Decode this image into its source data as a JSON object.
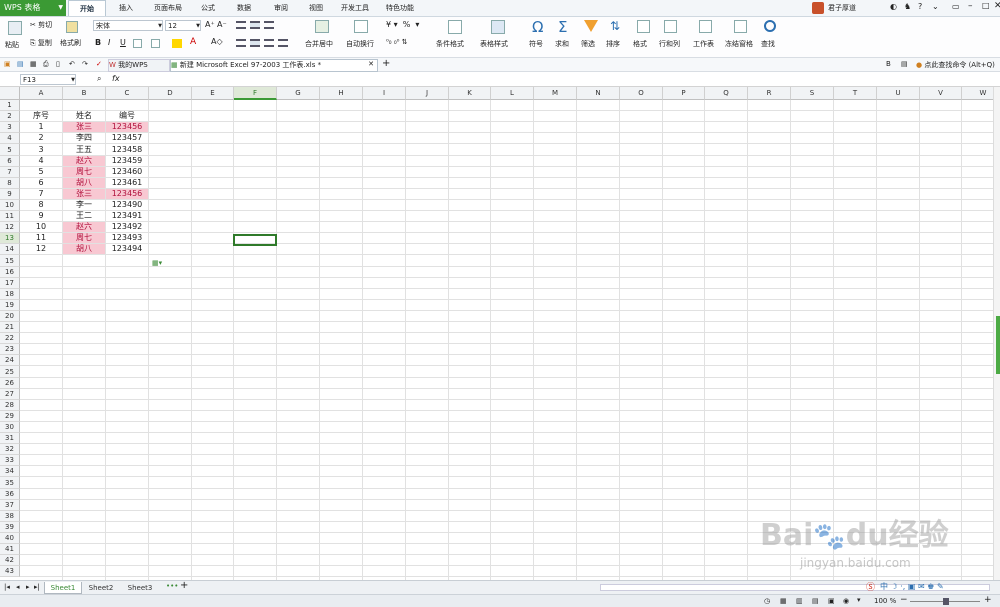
{
  "app": {
    "name": "WPS 表格"
  },
  "menu_tabs": [
    "开始",
    "插入",
    "页面布局",
    "公式",
    "数据",
    "审阅",
    "视图",
    "开发工具",
    "特色功能"
  ],
  "user": {
    "name": "君子厚道"
  },
  "ribbon": {
    "clipboard": {
      "paste": "粘贴",
      "cut": "剪切",
      "copy": "复制",
      "format_painter": "格式刷"
    },
    "font_name": "宋体",
    "font_size": "12",
    "merge": "合并居中",
    "wrap": "自动换行",
    "cond_format": "条件格式",
    "table_style": "表格样式",
    "symbol": "符号",
    "sum": "求和",
    "filter": "筛选",
    "sort": "排序",
    "format": "格式",
    "rowcol": "行和列",
    "worksheet": "工作表",
    "freeze": "冻结窗格",
    "find": "查找"
  },
  "doc_tabs": {
    "my_wps": "我的WPS",
    "current": "新建 Microsoft Excel 97-2003 工作表.xls *"
  },
  "search_hint": "点此查找命令 (Alt+Q)",
  "formula": {
    "cell_ref": "F13",
    "fx": "fx",
    "content": ""
  },
  "columns": [
    "A",
    "B",
    "C",
    "D",
    "E",
    "F",
    "G",
    "H",
    "I",
    "J",
    "K",
    "L",
    "M",
    "N",
    "O",
    "P",
    "Q",
    "R",
    "S",
    "T",
    "U",
    "V",
    "W"
  ],
  "rows": [
    "1",
    "2",
    "3",
    "4",
    "5",
    "6",
    "7",
    "8",
    "9",
    "10",
    "11",
    "12",
    "13",
    "14",
    "15",
    "16",
    "17",
    "18",
    "19",
    "20",
    "21",
    "22",
    "23",
    "24",
    "25",
    "26",
    "27",
    "28",
    "29",
    "30",
    "31",
    "32",
    "33",
    "34",
    "35",
    "36",
    "37",
    "38",
    "39",
    "40",
    "41",
    "42",
    "43"
  ],
  "headers": [
    "序号",
    "姓名",
    "编号"
  ],
  "data_rows": [
    {
      "a": "1",
      "b": "张三",
      "c": "123456",
      "hb": true,
      "hc": true
    },
    {
      "a": "2",
      "b": "李四",
      "c": "123457",
      "hb": false,
      "hc": false
    },
    {
      "a": "3",
      "b": "王五",
      "c": "123458",
      "hb": false,
      "hc": false
    },
    {
      "a": "4",
      "b": "赵六",
      "c": "123459",
      "hb": true,
      "hc": false
    },
    {
      "a": "5",
      "b": "周七",
      "c": "123460",
      "hb": true,
      "hc": false
    },
    {
      "a": "6",
      "b": "胡八",
      "c": "123461",
      "hb": true,
      "hc": false
    },
    {
      "a": "7",
      "b": "张三",
      "c": "123456",
      "hb": true,
      "hc": true
    },
    {
      "a": "8",
      "b": "李一",
      "c": "123490",
      "hb": false,
      "hc": false
    },
    {
      "a": "9",
      "b": "王二",
      "c": "123491",
      "hb": false,
      "hc": false
    },
    {
      "a": "10",
      "b": "赵六",
      "c": "123492",
      "hb": true,
      "hc": false
    },
    {
      "a": "11",
      "b": "周七",
      "c": "123493",
      "hb": true,
      "hc": false
    },
    {
      "a": "12",
      "b": "胡八",
      "c": "123494",
      "hb": true,
      "hc": false
    }
  ],
  "highlight_color": "#f8c8d2",
  "accent_color": "#3b9a34",
  "sheets": [
    "Sheet1",
    "Sheet2",
    "Sheet3"
  ],
  "active_sheet": "Sheet1",
  "zoom": "100 %",
  "watermark": "Baidu经验 jingyan.baidu.com"
}
